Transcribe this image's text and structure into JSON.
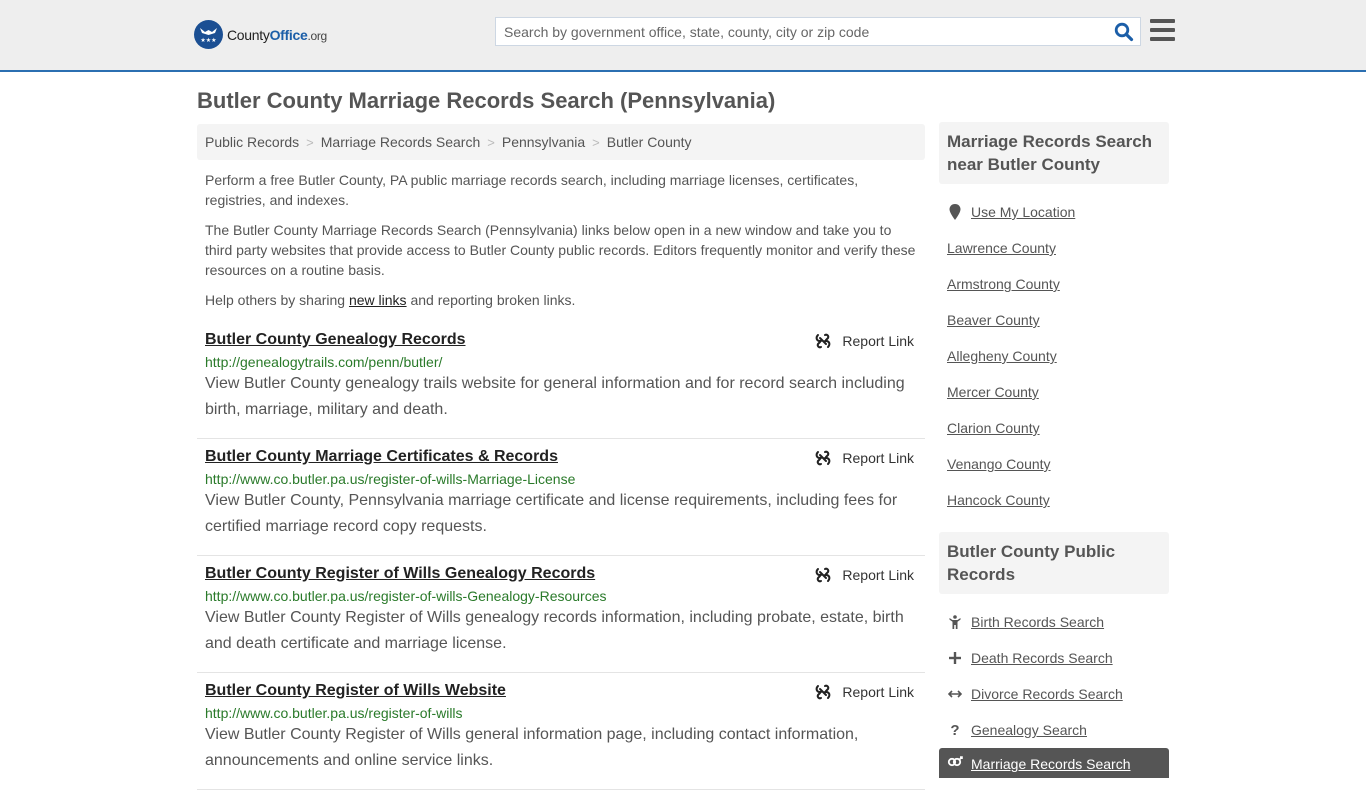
{
  "header": {
    "logo": {
      "name": "County",
      "office": "Office",
      "tld": ".org"
    },
    "search_placeholder": "Search by government office, state, county, city or zip code",
    "search_value": ""
  },
  "page_title": "Butler County Marriage Records Search (Pennsylvania)",
  "breadcrumb": [
    "Public Records",
    "Marriage Records Search",
    "Pennsylvania",
    "Butler County"
  ],
  "intro": {
    "p1": "Perform a free Butler County, PA public marriage records search, including marriage licenses, certificates, registries, and indexes.",
    "p2": "The Butler County Marriage Records Search (Pennsylvania) links below open in a new window and take you to third party websites that provide access to Butler County public records. Editors frequently monitor and verify these resources on a routine basis.",
    "p3_before": "Help others by sharing ",
    "p3_link": "new links",
    "p3_after": " and reporting broken links."
  },
  "report_label": "Report Link",
  "results": [
    {
      "title": "Butler County Genealogy Records",
      "url": "http://genealogytrails.com/penn/butler/",
      "desc": "View Butler County genealogy trails website for general information and for record search including birth, marriage, military and death."
    },
    {
      "title": "Butler County Marriage Certificates & Records",
      "url": "http://www.co.butler.pa.us/register-of-wills-Marriage-License",
      "desc": "View Butler County, Pennsylvania marriage certificate and license requirements, including fees for certified marriage record copy requests."
    },
    {
      "title": "Butler County Register of Wills Genealogy Records",
      "url": "http://www.co.butler.pa.us/register-of-wills-Genealogy-Resources",
      "desc": "View Butler County Register of Wills genealogy records information, including probate, estate, birth and death certificate and marriage license."
    },
    {
      "title": "Butler County Register of Wills Website",
      "url": "http://www.co.butler.pa.us/register-of-wills",
      "desc": "View Butler County Register of Wills general information page, including contact information, announcements and online service links."
    }
  ],
  "sidebar": {
    "nearby": {
      "heading": "Marriage Records Search near Butler County",
      "use_location": "Use My Location",
      "counties": [
        "Lawrence County",
        "Armstrong County",
        "Beaver County",
        "Allegheny County",
        "Mercer County",
        "Clarion County",
        "Venango County",
        "Hancock County"
      ]
    },
    "public_records": {
      "heading": "Butler County Public Records",
      "items": [
        {
          "label": "Birth Records Search",
          "icon": "child-icon"
        },
        {
          "label": "Death Records Search",
          "icon": "plus-icon"
        },
        {
          "label": "Divorce Records Search",
          "icon": "arrows-h-icon"
        },
        {
          "label": "Genealogy Search",
          "icon": "question-icon"
        },
        {
          "label": "Marriage Records Search",
          "icon": "venus-mars-icon",
          "active": true
        }
      ]
    }
  }
}
